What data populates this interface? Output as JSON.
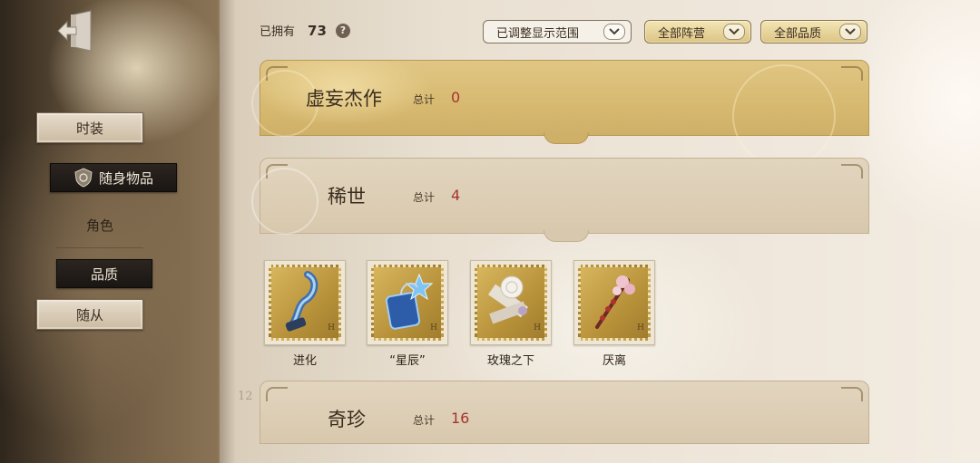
{
  "sidebar": {
    "items": [
      {
        "label": "时装"
      },
      {
        "label": "随身物品"
      },
      {
        "label": "角色"
      },
      {
        "label": "品质"
      },
      {
        "label": "随从"
      }
    ]
  },
  "header": {
    "owned_label": "已拥有",
    "owned_count": "73",
    "help_symbol": "?",
    "filters": [
      {
        "label": "已调整显示范围"
      },
      {
        "label": "全部阵营"
      },
      {
        "label": "全部品质"
      }
    ]
  },
  "sections": [
    {
      "title": "虚妄杰作",
      "total_label": "总计",
      "total": "0"
    },
    {
      "title": "稀世",
      "total_label": "总计",
      "total": "4"
    },
    {
      "title": "奇珍",
      "total_label": "总计",
      "total": "16"
    }
  ],
  "items": [
    {
      "name": "进化",
      "icon": "blue-vial-icon"
    },
    {
      "name": "“星辰”",
      "icon": "star-pendant-icon"
    },
    {
      "name": "玫瑰之下",
      "icon": "white-rose-icon"
    },
    {
      "name": "厌离",
      "icon": "pink-blossom-branch-icon"
    }
  ],
  "stamp_mark": "H",
  "side_number": "12",
  "colors": {
    "accent_gold": "#d7b970",
    "total_red": "#a7342e"
  }
}
